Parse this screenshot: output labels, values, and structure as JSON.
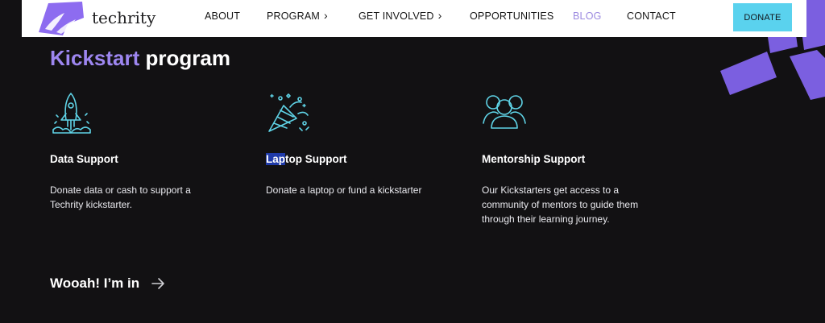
{
  "header": {
    "brand": "techrity",
    "nav": [
      {
        "label": "ABOUT"
      },
      {
        "label": "PROGRAM",
        "chevron": "›"
      },
      {
        "label": "GET INVOLVED",
        "chevron": "›"
      },
      {
        "label": "OPPORTUNITIES"
      },
      {
        "label": "BLOG",
        "active": true
      },
      {
        "label": "CONTACT"
      }
    ],
    "donate_label": "DONATE"
  },
  "section": {
    "title_accent": "Kickstart",
    "title_rest": " program"
  },
  "cards": [
    {
      "icon": "rocket-icon",
      "title": "Data Support",
      "description": "Donate data or cash to support a Techrity kickstarter."
    },
    {
      "icon": "party-popper-icon",
      "title_highlight": "Lap",
      "title_rest": "top Support",
      "description": "Donate a laptop or fund a kickstarter"
    },
    {
      "icon": "people-icon",
      "title": "Mentorship Support",
      "description": "Our Kickstarters get access to a community of mentors to guide them through their learning journey."
    }
  ],
  "cta": {
    "label": "Wooah! I’m in",
    "icon": "arrow-right-icon"
  },
  "colors": {
    "background": "#121113",
    "accent_purple": "#9d86f0",
    "icon_cyan": "#5fd3e6",
    "donate_bg": "#5ad2ee",
    "deco_purple": "#7b5fe0"
  }
}
